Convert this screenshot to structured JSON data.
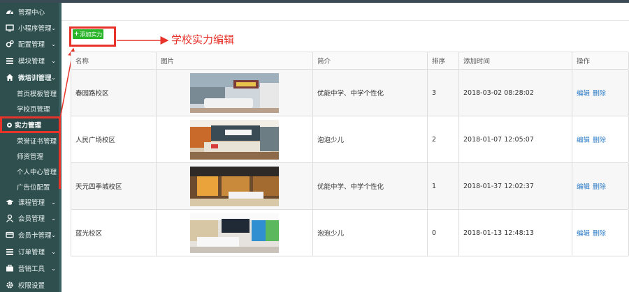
{
  "sidebar": {
    "items": [
      {
        "label": "管理中心",
        "icon": "dashboard-icon",
        "arrow": ""
      },
      {
        "label": "小程序管理",
        "icon": "monitor-icon",
        "arrow": "⌄"
      },
      {
        "label": "配置管理",
        "icon": "cogs-icon",
        "arrow": "⌄"
      },
      {
        "label": "模块管理",
        "icon": "list-icon",
        "arrow": "⌄"
      },
      {
        "label": "微培训管理",
        "icon": "home-icon",
        "arrow": "⌄"
      }
    ],
    "subitems": [
      "首页模板管理",
      "学校页管理",
      "实力管理",
      "荣誉证书管理",
      "师资管理",
      "个人中心管理",
      "广告位配置"
    ],
    "items2": [
      {
        "label": "课程管理",
        "icon": "graduation-cap-icon",
        "arrow": "⌄"
      },
      {
        "label": "会员管理",
        "icon": "user-icon",
        "arrow": "⌄"
      },
      {
        "label": "会员卡管理",
        "icon": "credit-card-icon",
        "arrow": "⌄"
      },
      {
        "label": "订单管理",
        "icon": "list-icon",
        "arrow": "⌄"
      },
      {
        "label": "营销工具",
        "icon": "briefcase-icon",
        "arrow": "⌄"
      },
      {
        "label": "权限设置",
        "icon": "gear-icon",
        "arrow": ""
      }
    ]
  },
  "toolbar": {
    "add_label": "添加实力"
  },
  "annotation": {
    "text": "学校实力编辑"
  },
  "table": {
    "headers": [
      "名称",
      "图片",
      "简介",
      "排序",
      "添加时间",
      "操作"
    ],
    "rows": [
      {
        "name": "春园路校区",
        "intro": "优能中学、中学个性化",
        "sort": "3",
        "time": "2018-03-02 08:28:02",
        "edit": "编辑",
        "del": "删除",
        "photo": "photo-1"
      },
      {
        "name": "人民广场校区",
        "intro": "泡泡少儿",
        "sort": "2",
        "time": "2018-01-07 12:05:07",
        "edit": "编辑",
        "del": "删除",
        "photo": "photo-2"
      },
      {
        "name": "天元四季城校区",
        "intro": "优能中学、中学个性化",
        "sort": "1",
        "time": "2018-01-37 12:02:37",
        "edit": "编辑",
        "del": "删除",
        "photo": "photo-3"
      },
      {
        "name": "蓝光校区",
        "intro": "泡泡少儿",
        "sort": "0",
        "time": "2018-01-13 12:48:13",
        "edit": "编辑",
        "del": "删除",
        "photo": "photo-4"
      }
    ]
  },
  "colors": {
    "sidebar_bg": "#2f4f4f",
    "add_button": "#2bb52b",
    "annotation_red": "#e8332b",
    "link_blue": "#2d7cc7"
  }
}
